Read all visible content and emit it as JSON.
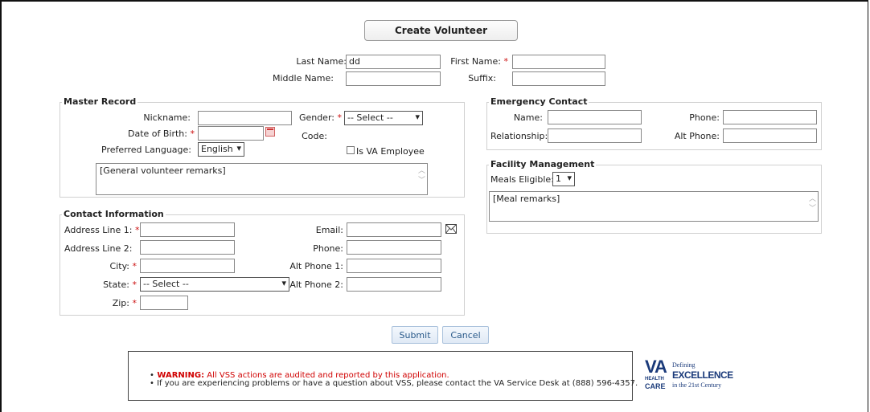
{
  "header": {
    "title": "Create Volunteer"
  },
  "name": {
    "last_label": "Last Name:",
    "last_value": "dd",
    "first_label": "First Name:",
    "first_value": "",
    "middle_label": "Middle Name:",
    "middle_value": "",
    "suffix_label": "Suffix:",
    "suffix_value": "",
    "required_mark": "*"
  },
  "master_record": {
    "legend": "Master Record",
    "nickname_label": "Nickname:",
    "dob_label": "Date of Birth:",
    "language_label": "Preferred Language:",
    "language_value": "English",
    "gender_label": "Gender:",
    "gender_value": "-- Select --",
    "code_label": "Code:",
    "va_employee_label": "Is VA Employee",
    "remarks": "[General volunteer remarks]"
  },
  "emergency": {
    "legend": "Emergency Contact",
    "name_label": "Name:",
    "relationship_label": "Relationship:",
    "phone_label": "Phone:",
    "alt_phone_label": "Alt Phone:"
  },
  "facility": {
    "legend": "Facility Management",
    "meals_label": "Meals Eligible:",
    "meals_value": "1",
    "remarks": "[Meal remarks]"
  },
  "contact": {
    "legend": "Contact Information",
    "addr1_label": "Address Line 1:",
    "addr2_label": "Address Line 2:",
    "city_label": "City:",
    "state_label": "State:",
    "state_value": "-- Select --",
    "zip_label": "Zip:",
    "email_label": "Email:",
    "phone_label": "Phone:",
    "alt1_label": "Alt Phone 1:",
    "alt2_label": "Alt Phone 2:"
  },
  "actions": {
    "submit": "Submit",
    "cancel": "Cancel"
  },
  "footer": {
    "warning_prefix": "WARNING:",
    "warning_text": " All VSS actions are audited and reported by this application.",
    "help_text": "If you are experiencing problems or have a question about VSS, please contact the VA Service Desk at (888) 596-4357."
  },
  "logo": {
    "va": "VA",
    "health": "HEALTH",
    "care": "CARE",
    "defining": "Defining",
    "excellence": "EXCELLENCE",
    "century": "in the 21st Century",
    "brand_color": "#1a3a7a"
  },
  "colors": {
    "required": "#cc1111",
    "warning": "#d00000"
  }
}
